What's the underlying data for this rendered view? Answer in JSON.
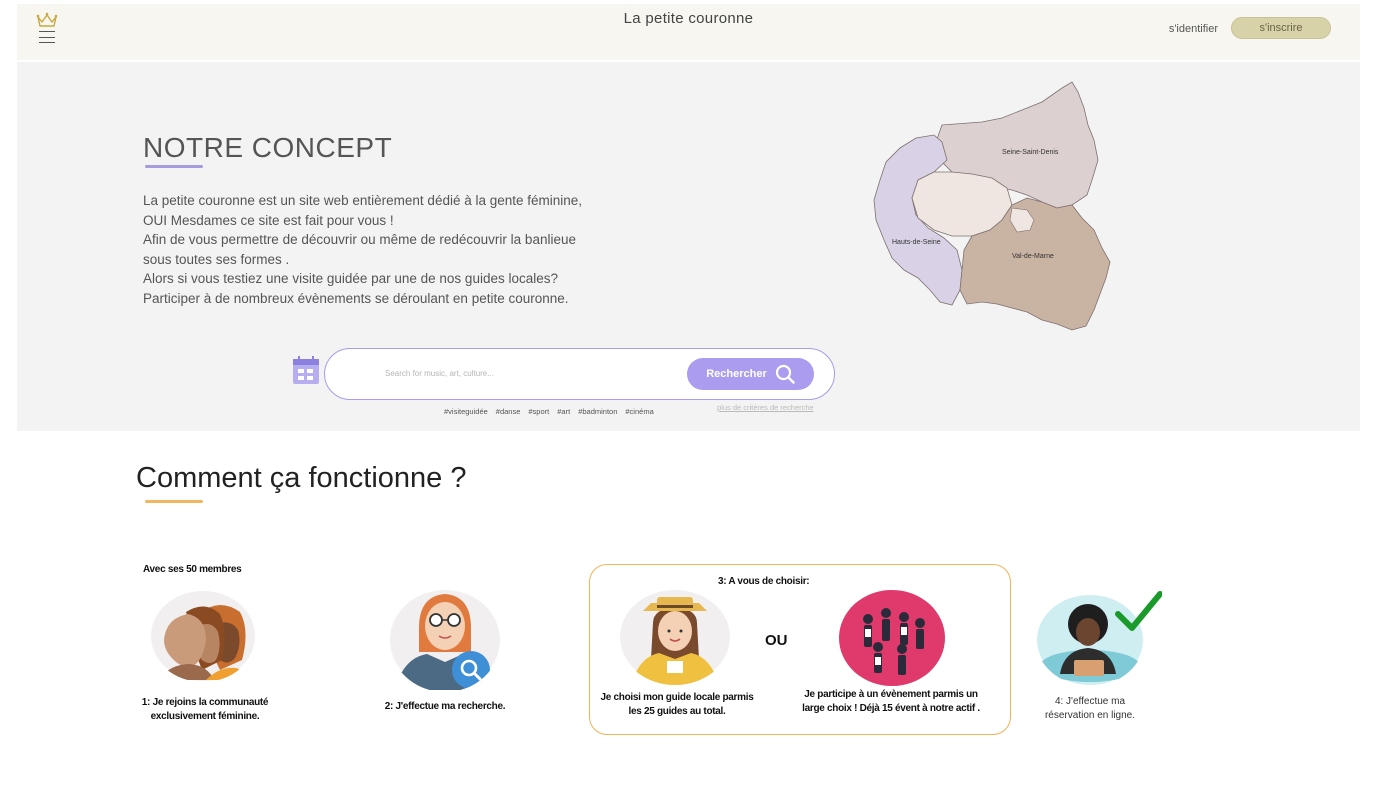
{
  "header": {
    "site_title": "La petite couronne",
    "login_label": "s'identifier",
    "register_label": "s'inscrire",
    "logo_icon": "crown-icon",
    "menu_icon": "hamburger-menu-icon"
  },
  "hero": {
    "title": "NOTRE CONCEPT",
    "paragraph_lines": [
      "La petite couronne est un site web entièrement dédié à la gente féminine,",
      "OUI Mesdames ce site est fait pour vous !",
      "Afin de vous permettre de découvrir ou même de redécouvrir la banlieue",
      "sous toutes ses formes .",
      "Alors si vous testiez une visite guidée par une de nos guides locales?",
      "Participer à de nombreux évènements  se déroulant en petite couronne."
    ],
    "map": {
      "regions": [
        "Seine-Saint-Denis",
        "Hauts-de-Seine",
        "Val-de-Marne"
      ],
      "colors": {
        "ssd": "#dcd0d0",
        "hds": "#d9d2e6",
        "paris": "#efe6e1",
        "vdm": "#c9b3a3"
      }
    }
  },
  "search": {
    "placeholder": "Search for music, art, culture...",
    "button_label": "Rechercher",
    "tags": [
      "#visiteguidée",
      "#danse",
      "#sport",
      "#art",
      "#badminton",
      "#cinéma"
    ],
    "more_criteria": "plus de critères de recherche"
  },
  "how": {
    "title": "Comment ça fonctionne ?",
    "step1_header": "Avec  ses 50 membres",
    "step1_caption": [
      "1: Je rejoins la communauté",
      "exclusivement féminine."
    ],
    "step2_caption": "2:  J'effectue ma recherche.",
    "step3_header": "3:  A vous de choisir:",
    "step3_left_caption": [
      "Je choisi mon guide locale parmis",
      "les 25 guides au total."
    ],
    "or_label": "OU",
    "step3_right_caption": [
      "Je participe à un évènement parmis un",
      "large choix ! Déjà 15 évent à notre actif ."
    ],
    "step4_caption": [
      "4:  J'effectue ma",
      "réservation en ligne."
    ]
  },
  "colors": {
    "accent_purple": "#ab9cf0",
    "accent_orange": "#f3b257",
    "register_button": "#d8d2a8",
    "hero_background": "#f3f3f3"
  }
}
